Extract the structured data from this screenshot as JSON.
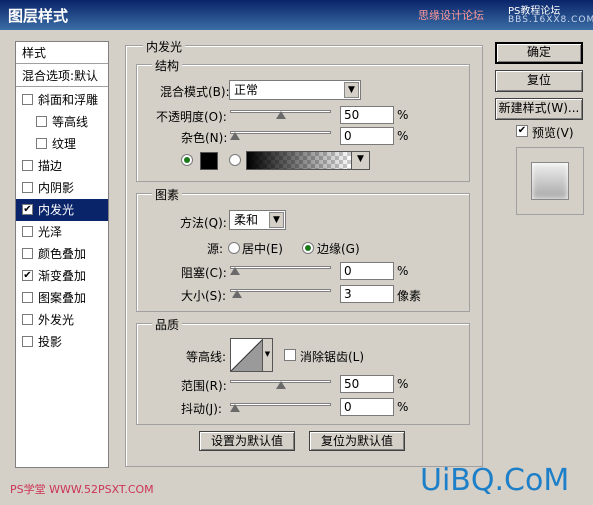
{
  "window": {
    "title": "图层样式",
    "watermark_center": "思缘设计论坛",
    "watermark_right_top": "PS教程论坛",
    "watermark_right_sub": "BBS.16XX8.COM"
  },
  "left_panel": {
    "header": "样式",
    "blend_options": "混合选项:默认",
    "items": [
      {
        "label": "斜面和浮雕",
        "checked": false,
        "indent": false
      },
      {
        "label": "等高线",
        "checked": false,
        "indent": true
      },
      {
        "label": "纹理",
        "checked": false,
        "indent": true
      },
      {
        "label": "描边",
        "checked": false,
        "indent": false
      },
      {
        "label": "内阴影",
        "checked": false,
        "indent": false
      },
      {
        "label": "内发光",
        "checked": true,
        "indent": false,
        "selected": true
      },
      {
        "label": "光泽",
        "checked": false,
        "indent": false
      },
      {
        "label": "颜色叠加",
        "checked": false,
        "indent": false
      },
      {
        "label": "渐变叠加",
        "checked": true,
        "indent": false
      },
      {
        "label": "图案叠加",
        "checked": false,
        "indent": false
      },
      {
        "label": "外发光",
        "checked": false,
        "indent": false
      },
      {
        "label": "投影",
        "checked": false,
        "indent": false
      }
    ]
  },
  "panel_title": "内发光",
  "structure": {
    "title": "结构",
    "blend_mode_label": "混合模式(B):",
    "blend_mode_value": "正常",
    "opacity_label": "不透明度(O):",
    "opacity_value": "50",
    "opacity_percent": 50,
    "noise_label": "杂色(N):",
    "noise_value": "0",
    "noise_percent": 0,
    "unit": "%"
  },
  "elements": {
    "title": "图素",
    "method_label": "方法(Q):",
    "method_value": "柔和",
    "source_label": "源:",
    "source_center": "居中(E)",
    "source_edge": "边缘(G)",
    "choke_label": "阻塞(C):",
    "choke_value": "0",
    "choke_percent": 0,
    "size_label": "大小(S):",
    "size_value": "3",
    "size_unit": "像素",
    "unit": "%"
  },
  "quality": {
    "title": "品质",
    "contour_label": "等高线:",
    "antialias_label": "消除锯齿(L)",
    "range_label": "范围(R):",
    "range_value": "50",
    "range_percent": 50,
    "jitter_label": "抖动(J):",
    "jitter_value": "0",
    "jitter_percent": 0,
    "unit": "%"
  },
  "buttons": {
    "set_default": "设置为默认值",
    "reset_default": "复位为默认值",
    "ok": "确定",
    "reset": "复位",
    "new_style": "新建样式(W)...",
    "preview": "预览(V)"
  },
  "watermarks": {
    "bottom_left": "PS学堂 WWW.52PSXT.COM",
    "bottom_right": "UiBQ.CoM"
  },
  "colors": {
    "glow_color": "#000000",
    "selection": "#0a246a"
  }
}
